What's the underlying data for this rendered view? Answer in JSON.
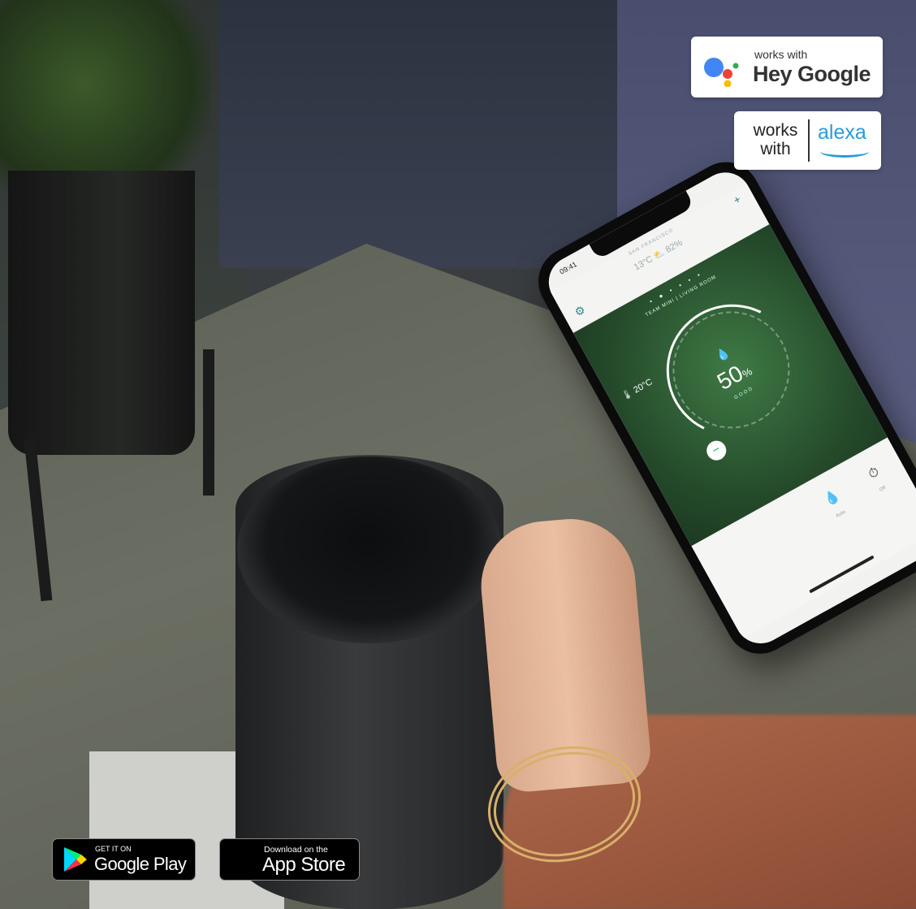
{
  "phone_app": {
    "status_time": "09:41",
    "city": "SAN FRANCISCO",
    "weather": "13°C  ⛅  82%",
    "room_label": "TEAM MINI  |  LIVING ROOM",
    "temperature": "20°C",
    "humidity_value": "50",
    "humidity_unit": "%",
    "humidity_status": "GOOD",
    "modes": [
      {
        "label": "Auto",
        "icon": "drop-icon"
      },
      {
        "label": "Off",
        "icon": "timer-icon"
      }
    ]
  },
  "badges": {
    "google": {
      "small": "works with",
      "big": "Hey Google"
    },
    "alexa": {
      "works": "works",
      "with": "with",
      "brand": "alexa"
    }
  },
  "stores": {
    "google_play": {
      "small": "GET IT ON",
      "big": "Google Play"
    },
    "app_store": {
      "small": "Download on the",
      "big": "App Store"
    }
  },
  "colors": {
    "accent_teal": "#2b8a86",
    "alexa_blue": "#2a9bd5",
    "app_green": "#2d5a33"
  }
}
